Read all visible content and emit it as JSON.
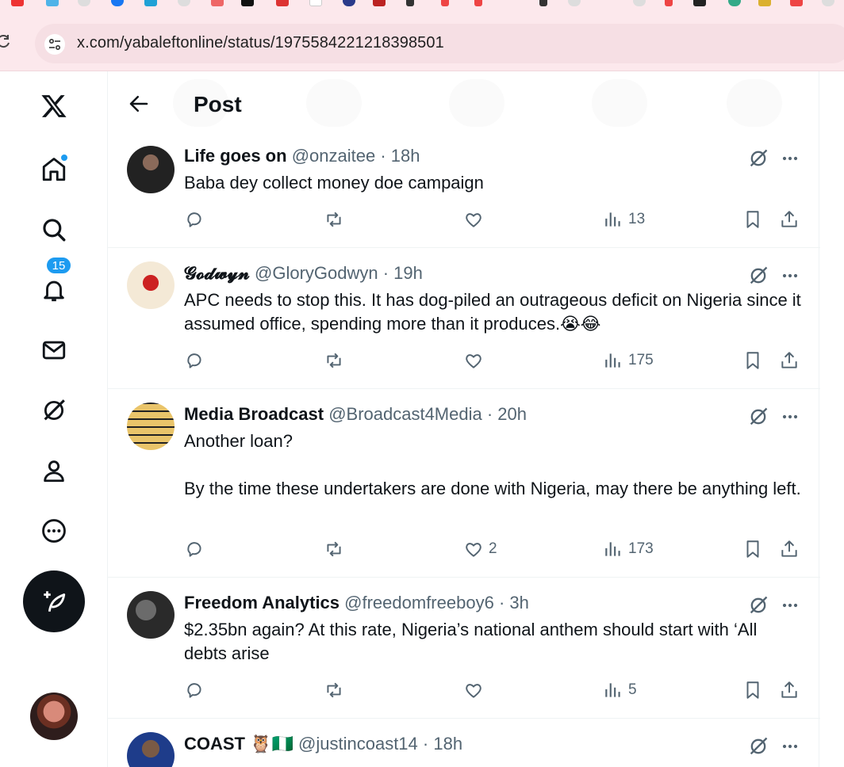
{
  "browser": {
    "url": "x.com/yabaleftonline/status/1975584221218398501"
  },
  "nav": {
    "notifications_count": "15"
  },
  "header": {
    "title": "Post"
  },
  "tweets": [
    {
      "name": "Life goes on",
      "handle": "@onzaitee",
      "time": "· 18h",
      "text": "Baba dey collect money doe campaign",
      "replies": "",
      "reposts": "",
      "likes": "",
      "views": "13"
    },
    {
      "name": "𝓖𝓸𝓭𝔀𝔂𝓷",
      "handle": "@GloryGodwyn",
      "time": "· 19h",
      "text": "APC needs to stop this. It has dog-piled an outrageous deficit on Nigeria since it assumed office, spending more than it produces.😭😂",
      "replies": "",
      "reposts": "",
      "likes": "",
      "views": "175"
    },
    {
      "name": "Media Broadcast",
      "handle": "@Broadcast4Media",
      "time": "· 20h",
      "text_line1": "Another loan?",
      "text_line2": "By the time these undertakers are done with Nigeria, may there be anything left.",
      "replies": "",
      "reposts": "",
      "likes": "2",
      "views": "173"
    },
    {
      "name": "Freedom Analytics",
      "handle": "@freedomfreeboy6",
      "time": "· 3h",
      "text": "$2.35bn again? At this rate, Nigeria’s national anthem should start with ‘All debts arise",
      "replies": "",
      "reposts": "",
      "likes": "",
      "views": "5"
    },
    {
      "name": "COAST 🦉🇳🇬",
      "handle": "@justincoast14",
      "time": "· 18h"
    }
  ]
}
